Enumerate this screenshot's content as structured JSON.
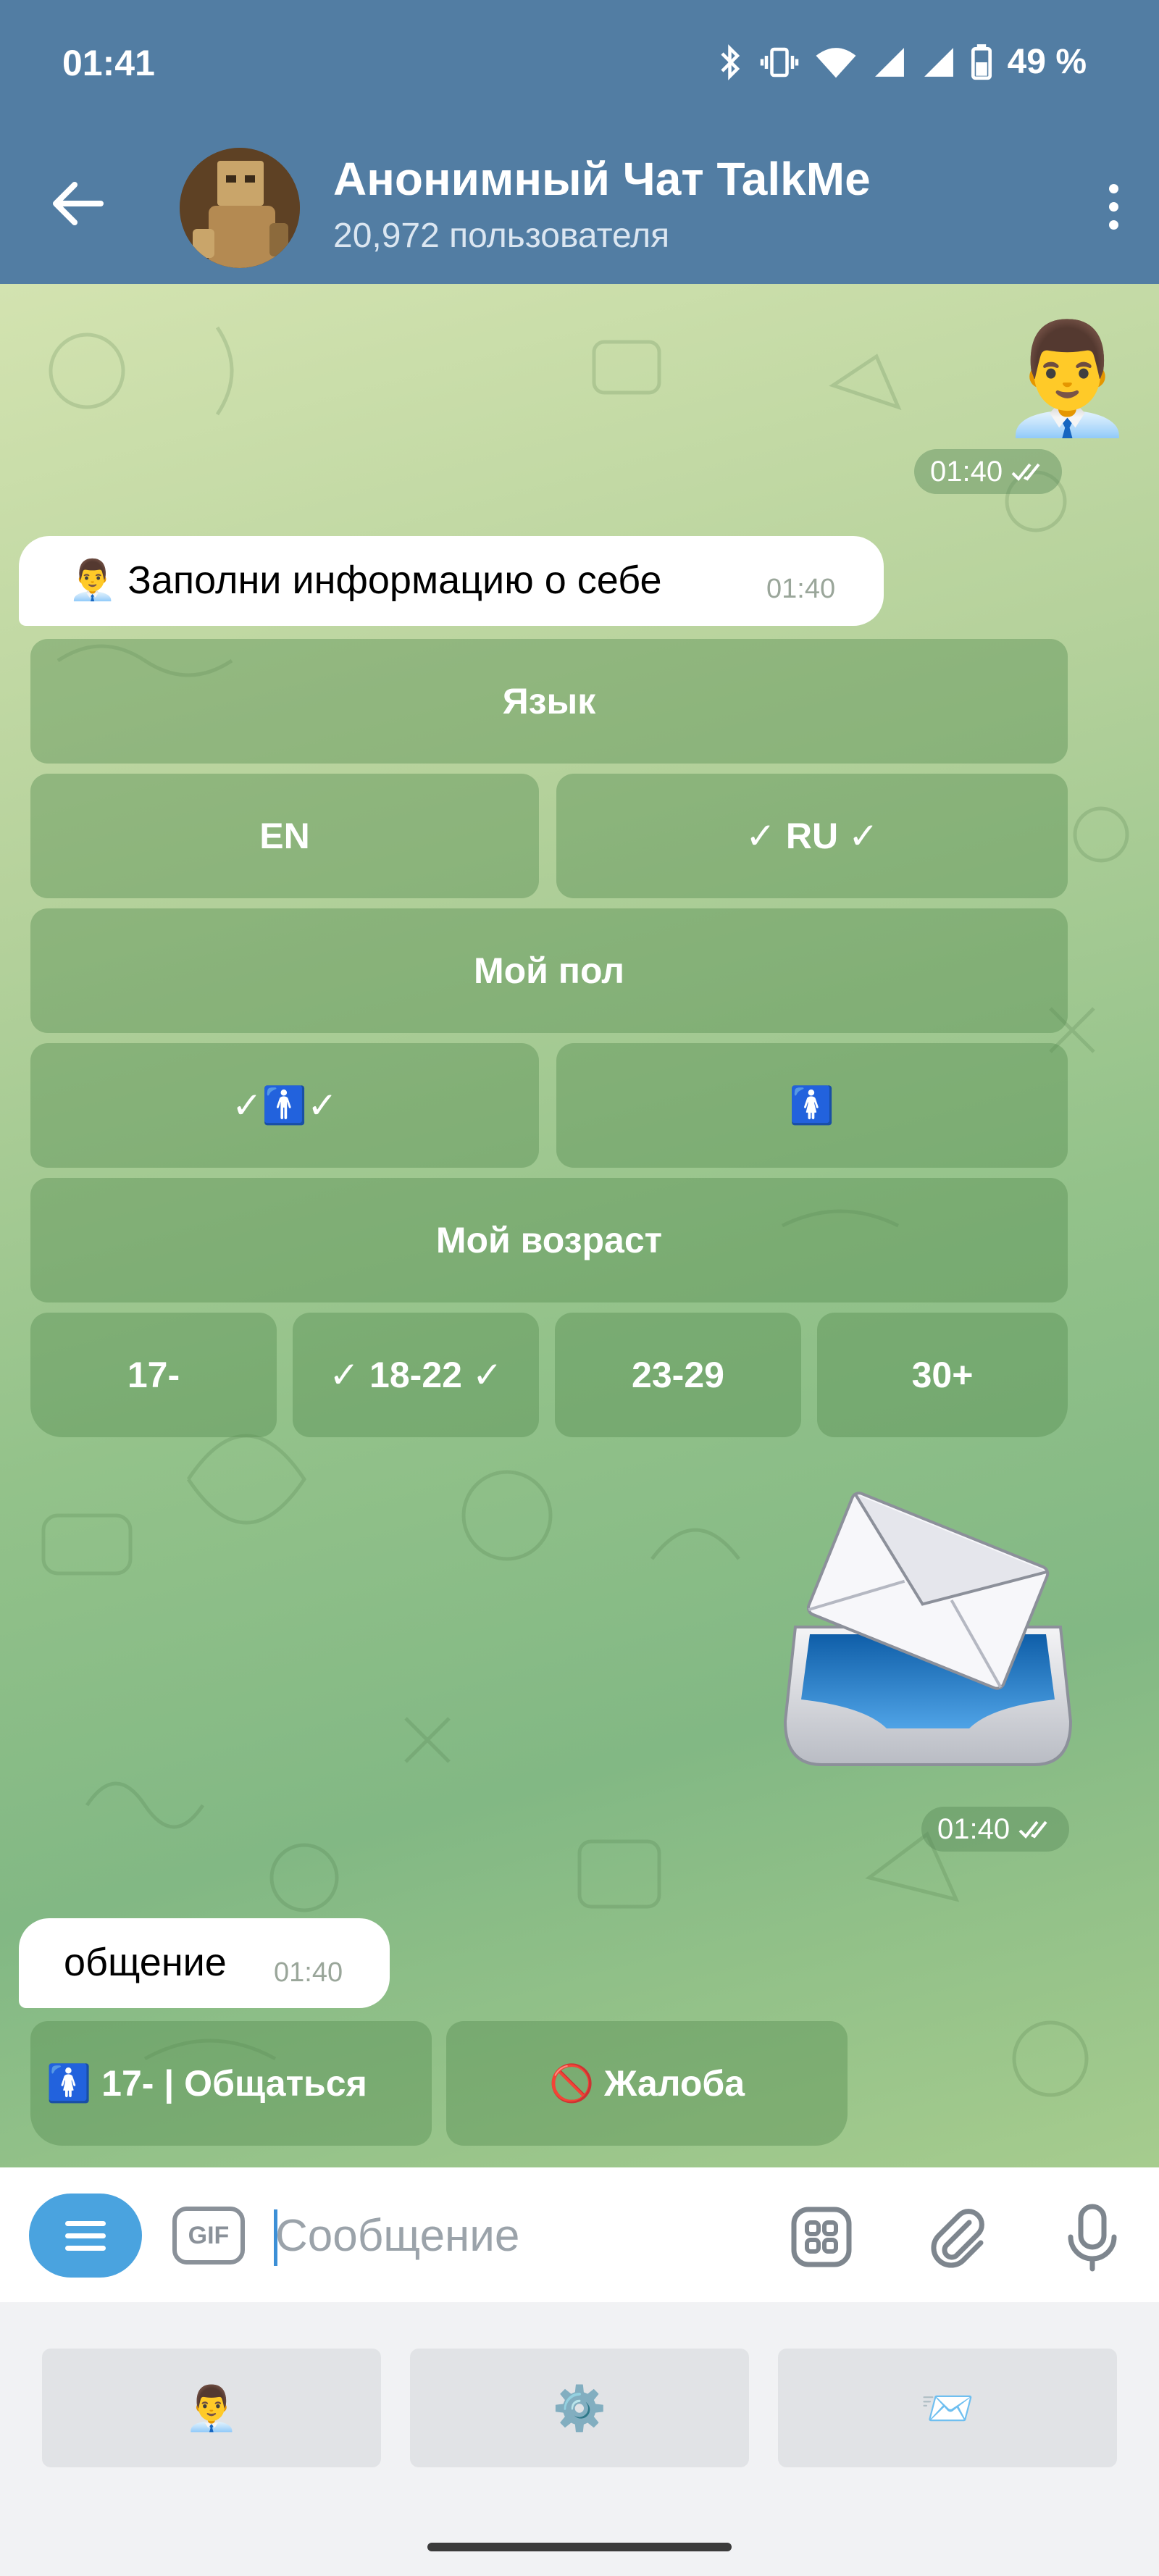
{
  "status_bar": {
    "time": "01:41",
    "battery": "49 %",
    "icons": [
      "bluetooth-icon",
      "vibrate-icon",
      "wifi-icon",
      "signal-icon",
      "signal-icon",
      "battery-icon"
    ]
  },
  "header": {
    "title": "Анонимный Чат TalkMe",
    "subtitle": "20,972 пользователя",
    "back_icon": "arrow-left-icon",
    "menu_icon": "more-vertical-icon"
  },
  "messages": {
    "outgoing_sticker_1": {
      "emoji": "👨‍💼",
      "time": "01:40",
      "status_icon": "double-check-icon"
    },
    "profile_message": {
      "text": "👨‍💼 Заполни информацию о себе",
      "time": "01:40"
    },
    "profile_keyboard": {
      "language_header": "Язык",
      "lang_en": "EN",
      "lang_ru": "✓ RU ✓",
      "gender_header": "Мой пол",
      "gender_male": "✓🚹✓",
      "gender_female": "🚺",
      "age_header": "Мой возраст",
      "age_options": [
        "17-",
        "✓ 18-22 ✓",
        "23-29",
        "30+"
      ]
    },
    "outgoing_sticker_2": {
      "emoji": "📨",
      "time": "01:40",
      "status_icon": "double-check-icon"
    },
    "chat_message": {
      "text": "общение",
      "time": "01:40"
    },
    "chat_keyboard": {
      "chat_button": "🚺 17- | Общаться",
      "report_button": "🚫 Жалоба"
    }
  },
  "input_bar": {
    "placeholder": "Сообщение",
    "gif_label": "GIF"
  },
  "reply_keyboard": {
    "buttons": [
      "👨‍💼",
      "⚙️",
      "📨"
    ]
  },
  "colors": {
    "header": "#527da3",
    "accent": "#4aa3df",
    "keyboard_button": "rgba(85,140,80,0.42)"
  }
}
